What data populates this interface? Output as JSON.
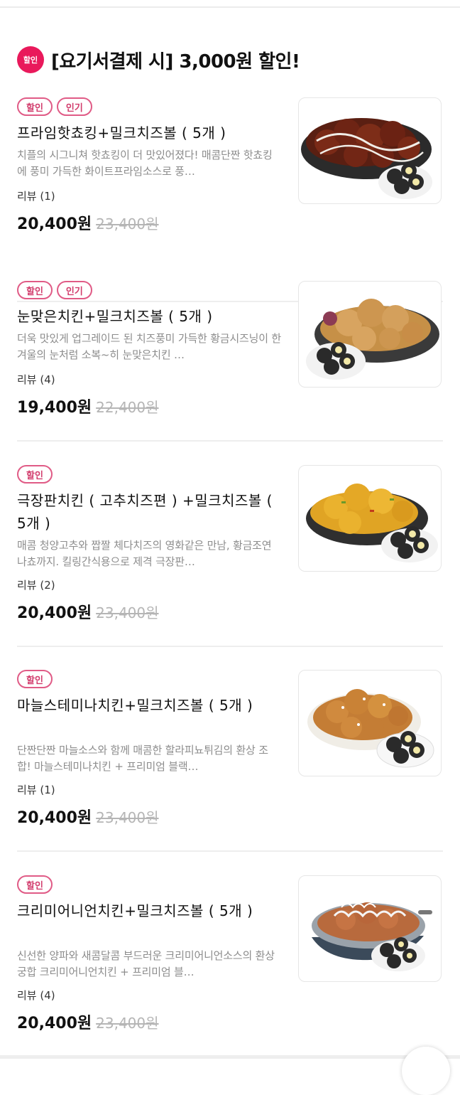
{
  "section": {
    "badge": "할인",
    "title": "[요기서결제 시] 3,000원 할인!"
  },
  "items": [
    {
      "tags": [
        "할인",
        "인기"
      ],
      "name": "프라임핫쵸킹+밀크치즈볼 ( 5개 )",
      "desc": "치플의 시그니쳐 핫쵸킹이 더 맛있어졌다! 매콤단짠 핫쵸킹에 풍미 가득한 화이트프라임소스로 풍…",
      "reviews": "리뷰 (1)",
      "price": "20,400원",
      "old_price": "23,400원",
      "image_icon": "glazed-chicken-with-cheese-balls"
    },
    {
      "tags": [
        "할인",
        "인기"
      ],
      "name": "눈맞은치킨+밀크치즈볼 ( 5개 )",
      "desc": "더욱 맛있게 업그레이드 된 치즈풍미 가득한 황금시즈닝이 한 겨울의 눈처럼 소복~히 눈맞은치킨 …",
      "reviews": "리뷰 (4)",
      "price": "19,400원",
      "old_price": "22,400원",
      "image_icon": "seasoned-fried-chicken-with-cheese-balls"
    },
    {
      "tags": [
        "할인"
      ],
      "name": "극장판치킨 ( 고추치즈편 ) +밀크치즈볼 ( 5개 )",
      "desc": "매콤 청양고추와 짭짤 체다치즈의 영화같은 만남, 황금조연 나쵸까지. 킬링간식용으로 제격 극장판…",
      "reviews": "리뷰 (2)",
      "price": "20,400원",
      "old_price": "23,400원",
      "image_icon": "cheese-pepper-chicken-with-cheese-balls"
    },
    {
      "tags": [
        "할인"
      ],
      "name": "마늘스테미나치킨+밀크치즈볼 ( 5개 )",
      "desc": "단짠단짠 마늘소스와 함께 매콤한 할라피뇨튀김의 환상 조합! 마늘스테미나치킨 + 프리미엄 블랙…",
      "reviews": "리뷰 (1)",
      "price": "20,400원",
      "old_price": "23,400원",
      "image_icon": "garlic-chicken-with-cheese-balls"
    },
    {
      "tags": [
        "할인"
      ],
      "name": "크리미어니언치킨+밀크치즈볼 ( 5개 )",
      "desc": "신선한 양파와 새콤달콤 부드러운 크리미어니언소스의 환상궁합 크리미어니언치킨 + 프리미엄 블…",
      "reviews": "리뷰 (4)",
      "price": "20,400원",
      "old_price": "23,400원",
      "image_icon": "onion-chicken-pan-with-cheese-balls"
    }
  ],
  "colors": {
    "accent": "#e9195b",
    "tag_border": "#e05b86",
    "muted_text": "#8d8d8d"
  }
}
